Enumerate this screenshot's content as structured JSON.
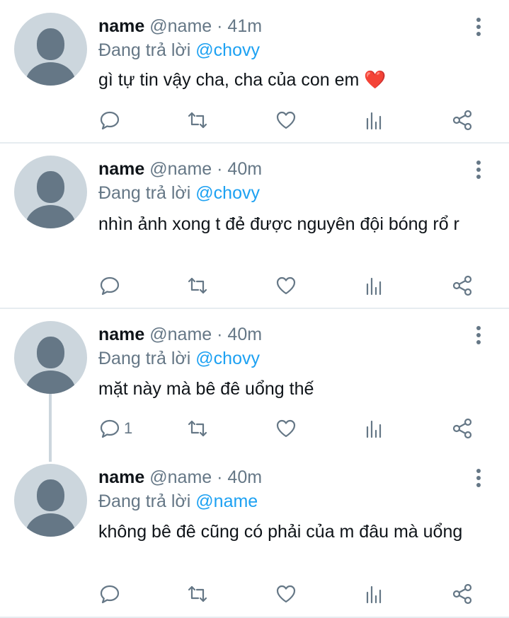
{
  "tweets": [
    {
      "name": "name",
      "handle": "@name",
      "separator": "·",
      "time": "41m",
      "reply_prefix": "Đang trả lời",
      "reply_to": "@chovy",
      "text": "gì tự tin vậy cha, cha của con em",
      "emoji": "❤️",
      "reply_count": ""
    },
    {
      "name": "name",
      "handle": "@name",
      "separator": "·",
      "time": "40m",
      "reply_prefix": "Đang trả lời",
      "reply_to": "@chovy",
      "text": "nhìn ảnh xong t đẻ được nguyên đội bóng rổ r",
      "reply_count": ""
    },
    {
      "name": "name",
      "handle": "@name",
      "separator": "·",
      "time": "40m",
      "reply_prefix": "Đang trả lời",
      "reply_to": "@chovy",
      "text": "mặt này mà bê đê uổng thế",
      "reply_count": "1"
    },
    {
      "name": "name",
      "handle": "@name",
      "separator": "·",
      "time": "40m",
      "reply_prefix": "Đang trả lời",
      "reply_to": "@name",
      "text": "không bê đê cũng có phải của m đâu mà uổng",
      "reply_count": ""
    }
  ],
  "icons": {
    "reply": "comment-icon",
    "retweet": "retweet-icon",
    "like": "heart-icon",
    "analytics": "analytics-icon",
    "share": "share-icon",
    "more": "more-vertical-icon"
  },
  "colors": {
    "accent": "#1da1f2",
    "secondary_text": "#657786",
    "avatar_bg": "#ccd6dd",
    "heart_emoji": "#e0245e"
  }
}
